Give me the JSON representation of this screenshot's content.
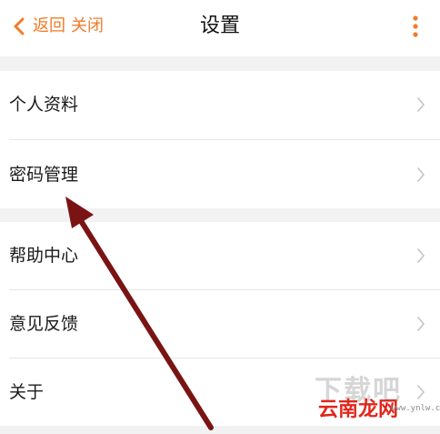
{
  "header": {
    "back_label": "返回",
    "close_label": "关闭",
    "title": "设置"
  },
  "icons": {
    "back": "chevron-left-icon",
    "more": "more-vertical-icon",
    "row_chevron": "chevron-right-icon"
  },
  "groups": [
    {
      "items": [
        {
          "label": "个人资料"
        },
        {
          "label": "密码管理"
        }
      ]
    },
    {
      "items": [
        {
          "label": "帮助中心"
        },
        {
          "label": "意见反馈"
        },
        {
          "label": "关于"
        }
      ]
    }
  ],
  "watermark": {
    "big": "下载吧",
    "brand": "云南龙网",
    "url": "www.ynlw.com"
  },
  "colors": {
    "accent": "#f07b2a",
    "background": "#f2f2f2",
    "annotation_arrow": "#7a1414",
    "watermark_brand": "#e0261b"
  }
}
